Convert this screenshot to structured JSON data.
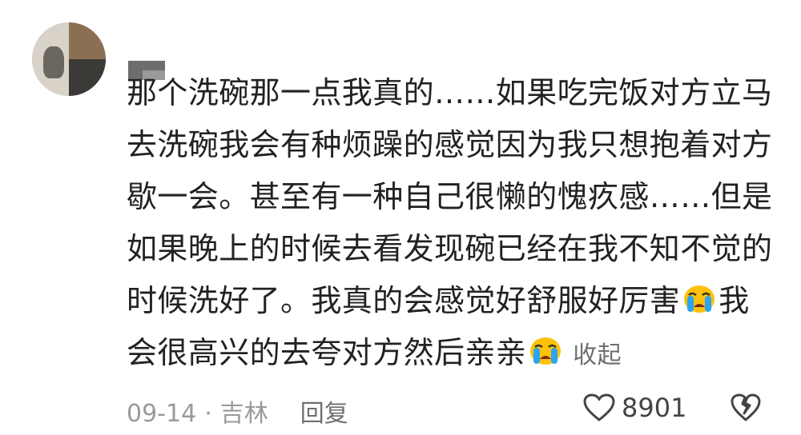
{
  "comment": {
    "lines": [
      "那个洗碗那一点我真的……如果吃完饭对方立马",
      "去洗碗我会有种烦躁的感觉因为我只想抱着对方",
      "歇一会。甚至有一种自己很懒的愧疚感……但是",
      "如果晚上的时候去看发现碗已经在我不知不觉的",
      "时候洗好了。我真的会感觉好舒服好厉害",
      "我",
      "会很高兴的去夸对方然后亲亲"
    ],
    "emoji": "crying-face",
    "collapse_label": "收起"
  },
  "meta": {
    "date": "09-14",
    "separator": "·",
    "location": "吉林",
    "reply_label": "回复"
  },
  "actions": {
    "like_count": "8901",
    "like_icon": "heart-outline-icon",
    "dislike_icon": "broken-heart-icon"
  },
  "colors": {
    "text": "#222222",
    "muted": "#9a9a9a",
    "emoji_face": "#ffc107",
    "emoji_tear": "#2aa4f4"
  }
}
